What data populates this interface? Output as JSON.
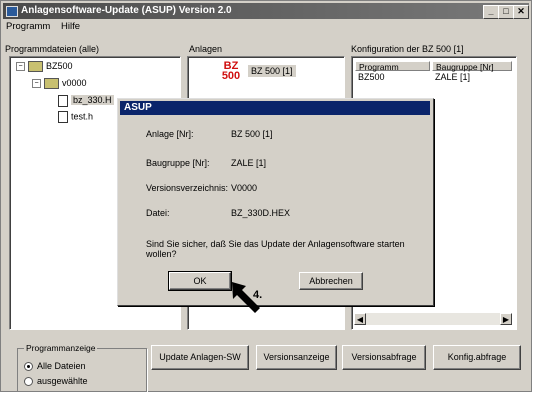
{
  "window": {
    "title": "Anlagensoftware-Update (ASUP) Version 2.0",
    "min_glyph": "_",
    "max_glyph": "□",
    "close_glyph": "✕"
  },
  "menu": [
    "Programm",
    "Hilfe"
  ],
  "sections": {
    "programs_label": "Programmdateien (alle)",
    "plants_label": "Anlagen",
    "config_label": "Konfiguration der BZ 500 [1]"
  },
  "tree": {
    "root": "BZ500",
    "sub": "v0000",
    "file1": "bz_330.H",
    "file2": "test.h"
  },
  "plant": {
    "logo_top": "BZ",
    "logo_bottom": "500",
    "name": "BZ 500 [1]"
  },
  "config": {
    "col1": "Programm",
    "col2": "Baugruppe [Nr]",
    "row_prog": "BZ500",
    "row_bg": "ZALE [1]"
  },
  "dialog": {
    "title": "ASUP",
    "anlage_label": "Anlage [Nr]:",
    "anlage_value": "BZ 500 [1]",
    "baugruppe_label": "Baugruppe [Nr]:",
    "baugruppe_value": "ZALE [1]",
    "version_label": "Versionsverzeichnis:",
    "version_value": "V0000",
    "datei_label": "Datei:",
    "datei_value": "BZ_330D.HEX",
    "question": "Sind Sie sicher, daß Sie das Update der Anlagensoftware starten wollen?",
    "ok": "OK",
    "cancel": "Abbrechen"
  },
  "annotation": "4.",
  "program_display": {
    "group_label": "Programmanzeige",
    "opt1": "Alle Dateien",
    "opt2": "ausgewählte",
    "selected": "Alle Dateien"
  },
  "buttons": {
    "update": "Update Anlagen-SW",
    "version_display": "Versionsanzeige",
    "version_query": "Versionsabfrage",
    "config_query": "Konfig.abfrage"
  },
  "scroll": {
    "left": "◀",
    "right": "▶"
  },
  "expander": {
    "root": "−",
    "sub": "−"
  },
  "colors": {
    "dialog_title": "#0a246a",
    "plant_logo": "#d01010"
  }
}
